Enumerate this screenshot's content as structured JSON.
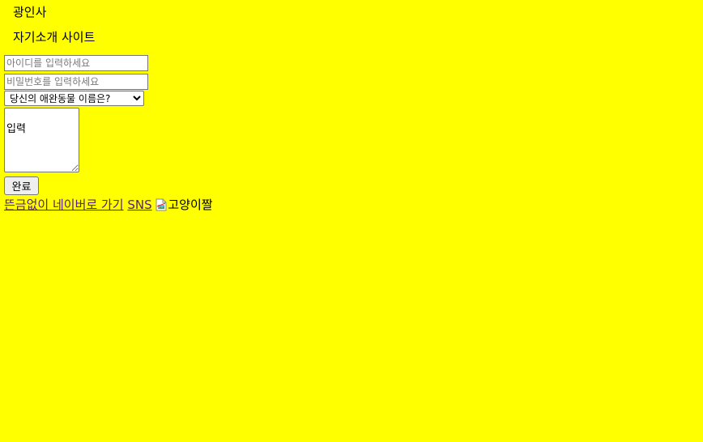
{
  "header": {
    "brand": "광인사",
    "subtitle": "자기소개 사이트"
  },
  "form": {
    "id_placeholder": "아이디를 입력하세요",
    "pw_placeholder": "비밀번호를 입력하세요",
    "pet_select_value": "당신의 애완동물 이름은?",
    "memo_value": "입력",
    "submit_label": "완료"
  },
  "links": {
    "naver_label": "뜬금없이 네이버로 가기",
    "sns_label": "SNS"
  },
  "image": {
    "alt_text": "고양이짤",
    "icon": "broken-image-icon"
  },
  "colors": {
    "background": "#ffff00",
    "visited_link": "#551a8b"
  }
}
